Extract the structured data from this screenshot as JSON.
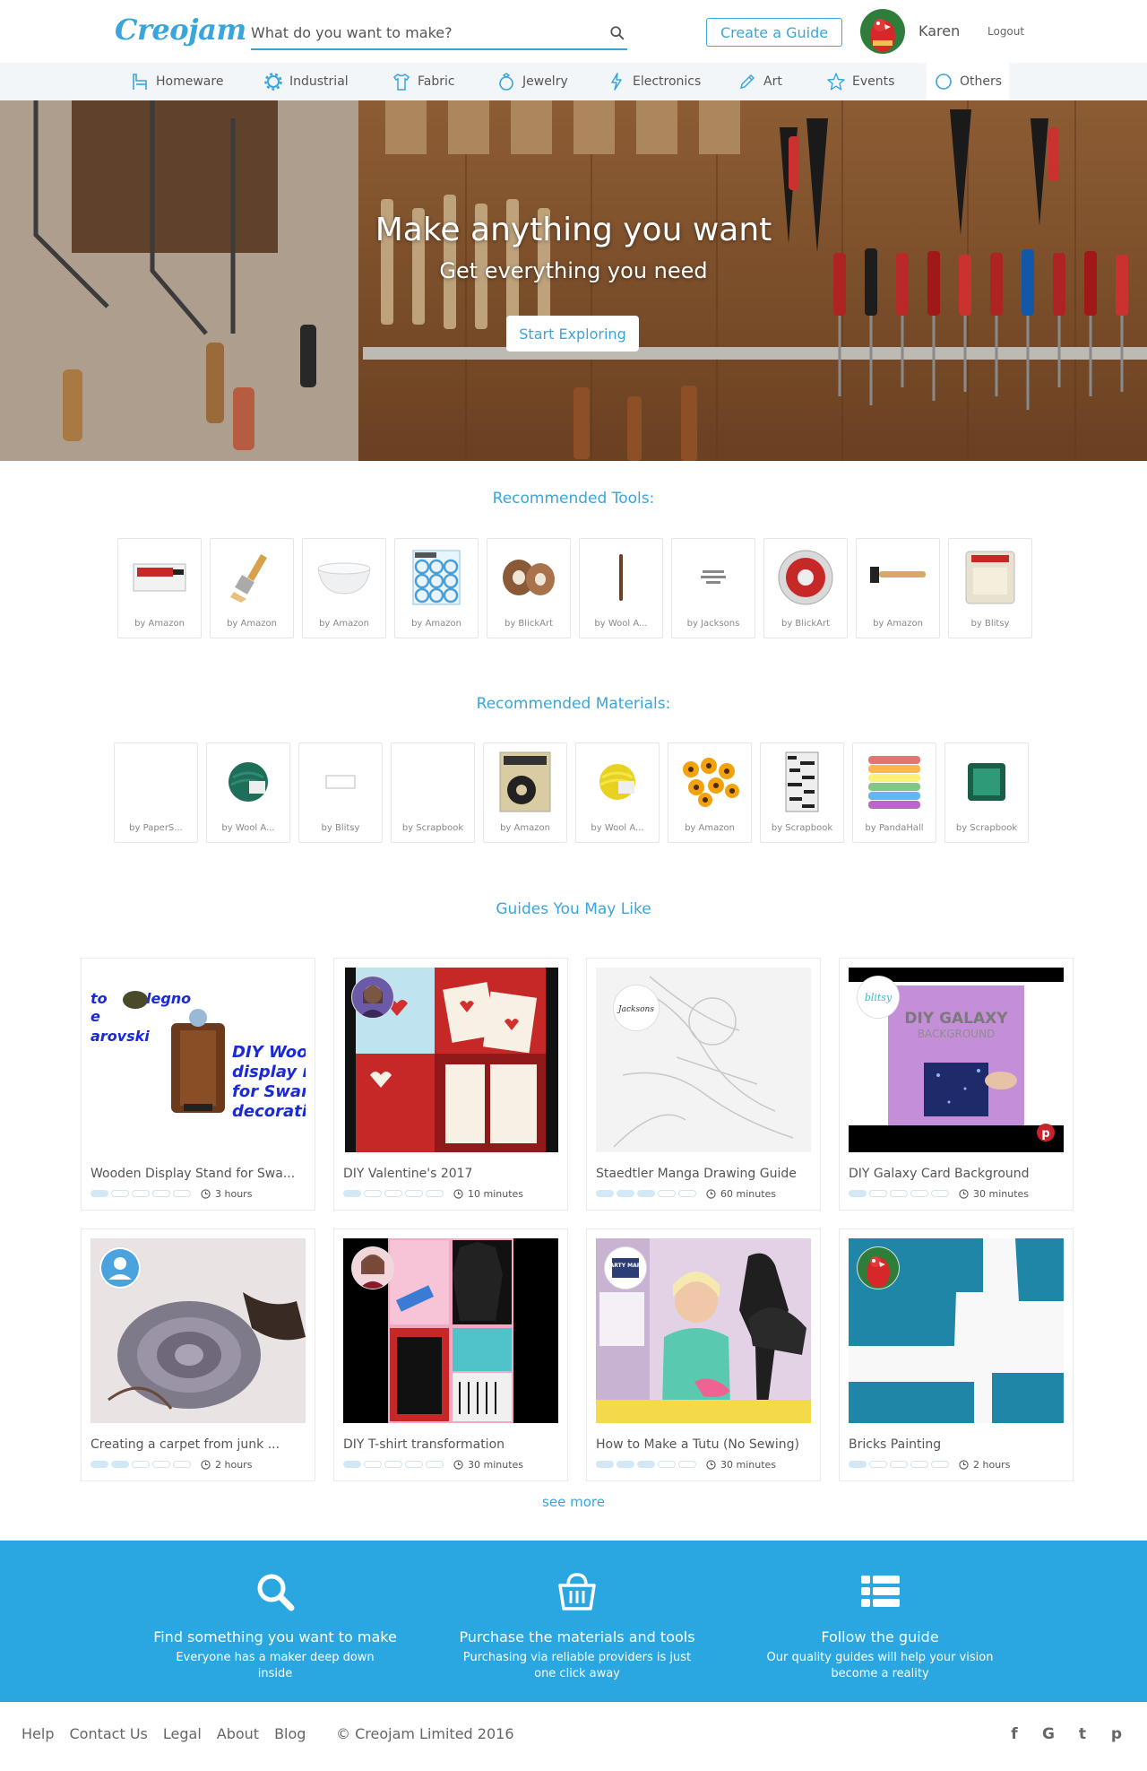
{
  "header": {
    "logo": "Creojam",
    "search_placeholder": "What do you want to make?",
    "create_label": "Create a Guide",
    "username": "Karen",
    "logout_label": "Logout"
  },
  "categories": [
    {
      "label": "Homeware",
      "icon": "crane-icon"
    },
    {
      "label": "Industrial",
      "icon": "gear-icon"
    },
    {
      "label": "Fabric",
      "icon": "shirt-icon"
    },
    {
      "label": "Jewelry",
      "icon": "ring-icon"
    },
    {
      "label": "Electronics",
      "icon": "bolt-icon"
    },
    {
      "label": "Art",
      "icon": "pencil-icon"
    },
    {
      "label": "Events",
      "icon": "star-icon"
    },
    {
      "label": "Others",
      "icon": "circle-icon"
    }
  ],
  "hero": {
    "title": "Make anything you want",
    "subtitle": "Get everything you need",
    "button": "Start Exploring"
  },
  "tools": {
    "title": "Recommended Tools:",
    "items": [
      {
        "by": "by Amazon",
        "thumb": "marker"
      },
      {
        "by": "by Amazon",
        "thumb": "brush"
      },
      {
        "by": "by Amazon",
        "thumb": "bowl"
      },
      {
        "by": "by Amazon",
        "thumb": "stencil"
      },
      {
        "by": "by BlickArt",
        "thumb": "tape"
      },
      {
        "by": "by Wool A...",
        "thumb": "needle"
      },
      {
        "by": "by Jacksons",
        "thumb": "coming-soon"
      },
      {
        "by": "by BlickArt",
        "thumb": "roll"
      },
      {
        "by": "by Amazon",
        "thumb": "hammer"
      },
      {
        "by": "by Blitsy",
        "thumb": "pack"
      }
    ]
  },
  "materials": {
    "title": "Recommended Materials:",
    "items": [
      {
        "by": "by PaperS...",
        "thumb": "blank"
      },
      {
        "by": "by Wool A...",
        "thumb": "yarn-green"
      },
      {
        "by": "by Blitsy",
        "thumb": "paper"
      },
      {
        "by": "by Scrapbook",
        "thumb": "blank"
      },
      {
        "by": "by Amazon",
        "thumb": "magnet"
      },
      {
        "by": "by Wool A...",
        "thumb": "yarn-yellow"
      },
      {
        "by": "by Amazon",
        "thumb": "flowers"
      },
      {
        "by": "by Scrapbook",
        "thumb": "pattern"
      },
      {
        "by": "by PandaHall",
        "thumb": "ribbons"
      },
      {
        "by": "by Scrapbook",
        "thumb": "inkpad"
      }
    ]
  },
  "guides_title": "Guides You May Like",
  "guides": [
    {
      "title": "Wooden Display Stand for Swa...",
      "time": "3 hours",
      "level": 1,
      "img": "wood"
    },
    {
      "title": "DIY Valentine's 2017",
      "time": "10 minutes",
      "level": 1,
      "img": "valentine"
    },
    {
      "title": "Staedtler Manga Drawing Guide",
      "time": "60 minutes",
      "level": 3,
      "img": "manga"
    },
    {
      "title": "DIY Galaxy Card Background",
      "time": "30 minutes",
      "level": 1,
      "img": "galaxy"
    },
    {
      "title": "Creating a carpet from junk ...",
      "time": "2 hours",
      "level": 2,
      "img": "carpet"
    },
    {
      "title": "DIY T-shirt transformation",
      "time": "30 minutes",
      "level": 1,
      "img": "tshirt"
    },
    {
      "title": "How to Make a Tutu (No Sewing)",
      "time": "30 minutes",
      "level": 3,
      "img": "tutu"
    },
    {
      "title": "Bricks Painting",
      "time": "2 hours",
      "level": 1,
      "img": "bricks"
    }
  ],
  "guide_image_text": {
    "wood": [
      "to",
      "legno",
      "e",
      "arovski",
      "DIY Woo",
      "display r",
      "for Swar",
      "decoratio"
    ],
    "manga_avatar": "Jacksons",
    "galaxy_avatar": "blitsy",
    "galaxy_title": "DIY GALAXY",
    "galaxy_sub": "BACKGROUND",
    "tutu_avatar": "PARTY MART"
  },
  "see_more": "see more",
  "features": [
    {
      "icon": "search-icon",
      "title": "Find something you want to make",
      "desc": "Everyone has a maker deep down inside"
    },
    {
      "icon": "basket-icon",
      "title": "Purchase the materials and tools",
      "desc": "Purchasing via reliable providers is just one click away"
    },
    {
      "icon": "list-icon",
      "title": "Follow the guide",
      "desc": "Our quality guides will help your vision become a reality"
    }
  ],
  "footer": {
    "links": [
      "Help",
      "Contact Us",
      "Legal",
      "About",
      "Blog"
    ],
    "copyright": "© Creojam Limited 2016",
    "social": [
      "f",
      "G",
      "t",
      "p"
    ]
  },
  "colors": {
    "accent": "#3aa5dc",
    "band": "#2aa6e0"
  }
}
